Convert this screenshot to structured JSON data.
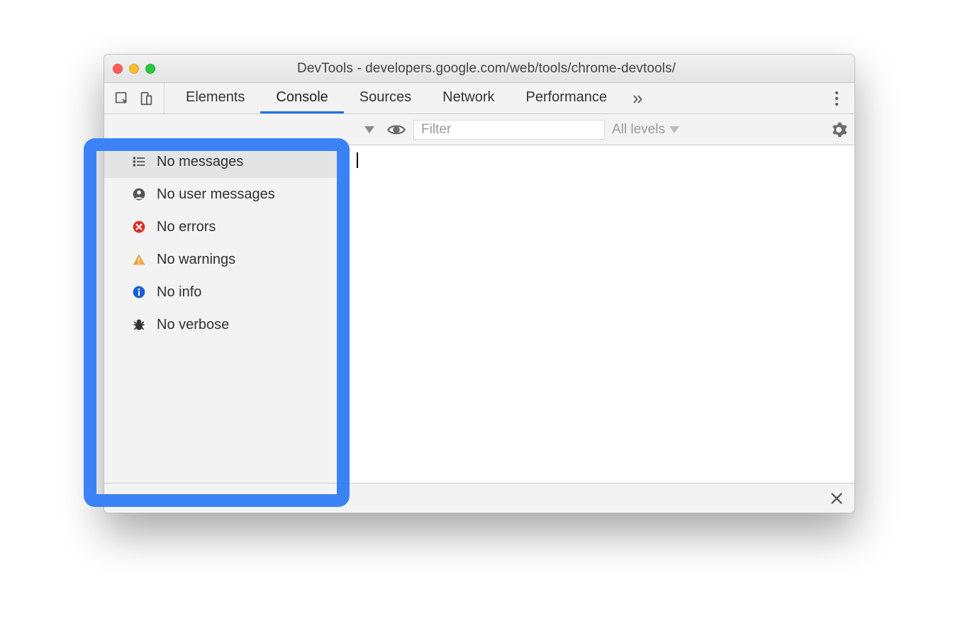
{
  "window": {
    "title": "DevTools - developers.google.com/web/tools/chrome-devtools/"
  },
  "tabs": {
    "items": [
      "Elements",
      "Console",
      "Sources",
      "Network",
      "Performance"
    ],
    "active_index": 1,
    "more_glyph": "»"
  },
  "filter": {
    "placeholder": "Filter",
    "levels_label": "All levels"
  },
  "sidebar": {
    "items": [
      {
        "icon": "list",
        "label": "No messages",
        "selected": true
      },
      {
        "icon": "user",
        "label": "No user messages",
        "selected": false
      },
      {
        "icon": "error",
        "label": "No errors",
        "selected": false
      },
      {
        "icon": "warning",
        "label": "No warnings",
        "selected": false
      },
      {
        "icon": "info",
        "label": "No info",
        "selected": false
      },
      {
        "icon": "bug",
        "label": "No verbose",
        "selected": false
      }
    ]
  },
  "colors": {
    "error": "#d93025",
    "warning": "#f0a33f",
    "info": "#1a5dd6",
    "highlight": "#3b82f6"
  }
}
